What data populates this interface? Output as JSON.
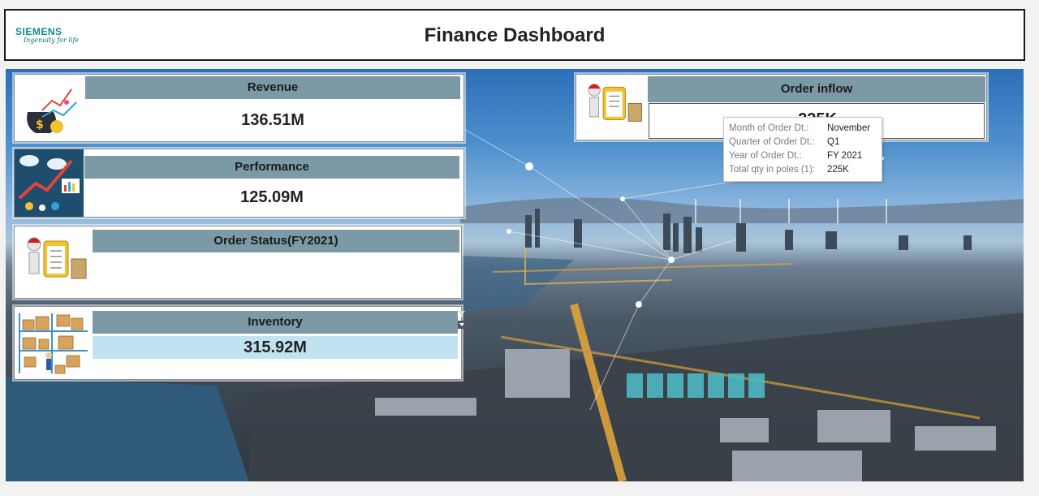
{
  "header": {
    "brand": "SIEMENS",
    "tagline": "Ingenuity for life",
    "title": "Finance Dashboard"
  },
  "cards": {
    "revenue": {
      "label": "Revenue",
      "value": "136.51M",
      "icon": "money-growth-icon"
    },
    "performance": {
      "label": "Performance",
      "value": "125.09M",
      "icon": "performance-chart-icon"
    },
    "order_status": {
      "label": "Order Status(FY2021)",
      "value": "",
      "icon": "clipboard-person-icon"
    },
    "inventory": {
      "label": "Inventory",
      "value": "315.92M",
      "icon": "warehouse-boxes-icon"
    },
    "order_inflow": {
      "label": "Order inflow",
      "value": "225K",
      "icon": "clipboard-person-icon"
    }
  },
  "tooltip": {
    "rows": [
      {
        "key": "Month of Order Dt.:",
        "value": "November"
      },
      {
        "key": "Quarter of Order Dt.:",
        "value": "Q1"
      },
      {
        "key": "Year of Order Dt.:",
        "value": "FY 2021"
      },
      {
        "key": "Total qty in poles (1):",
        "value": "225K"
      }
    ]
  },
  "colors": {
    "header_band": "#7b9aa6",
    "inventory_highlight": "#bfe3f0",
    "brand_teal": "#0f8a8c"
  }
}
